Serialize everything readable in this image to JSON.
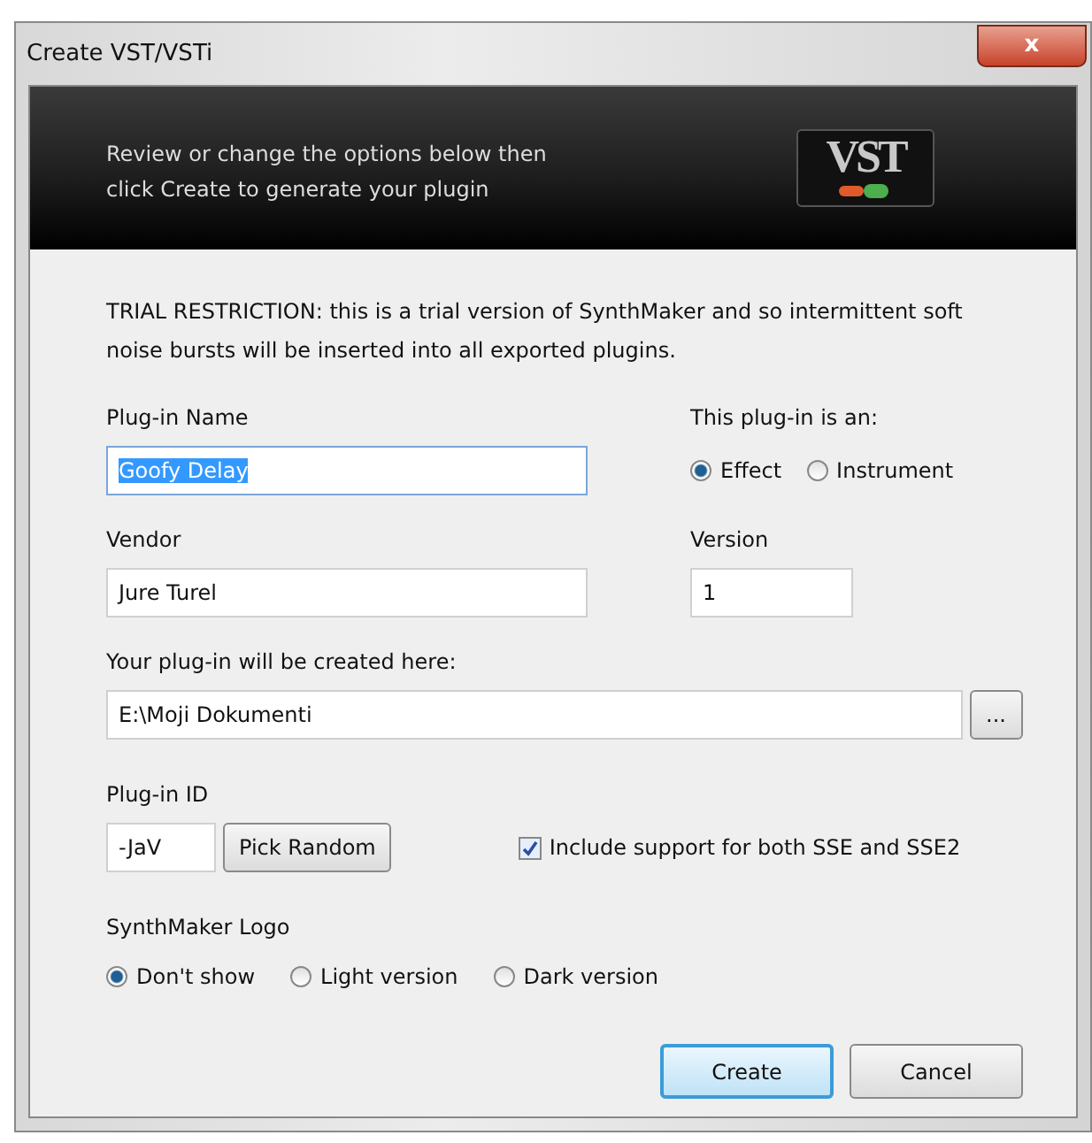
{
  "window": {
    "title": "Create VST/VSTi",
    "close_label": "x"
  },
  "header": {
    "lines": [
      "Review or change the options below then",
      "click Create to generate your plugin"
    ],
    "logo_text": "VST"
  },
  "notice": "TRIAL RESTRICTION: this is a trial version of SynthMaker and so intermittent soft noise bursts will be inserted into all exported plugins.",
  "plugin_name": {
    "label": "Plug-in Name",
    "value": "Goofy Delay",
    "highlighted": true
  },
  "plugin_type": {
    "label": "This plug-in is an:",
    "options": [
      {
        "label": "Effect",
        "selected": true
      },
      {
        "label": "Instrument",
        "selected": false
      }
    ]
  },
  "vendor": {
    "label": "Vendor",
    "value": "Jure Turel"
  },
  "version": {
    "label": "Version",
    "value": "1"
  },
  "location": {
    "label": "Your plug-in will be created here:",
    "value": "E:\\Moji Dokumenti",
    "browse_label": "..."
  },
  "plugin_id": {
    "label": "Plug-in ID",
    "value": "-JaV",
    "button": "Pick Random"
  },
  "sse": {
    "label": "Include support for both SSE and SSE2",
    "checked": true
  },
  "logo": {
    "label": "SynthMaker Logo",
    "options": [
      {
        "label": "Don't show",
        "selected": true
      },
      {
        "label": "Light version",
        "selected": false
      },
      {
        "label": "Dark version",
        "selected": false
      }
    ]
  },
  "buttons": [
    {
      "label": "Create",
      "default": true
    },
    {
      "label": "Cancel",
      "default": false
    }
  ]
}
